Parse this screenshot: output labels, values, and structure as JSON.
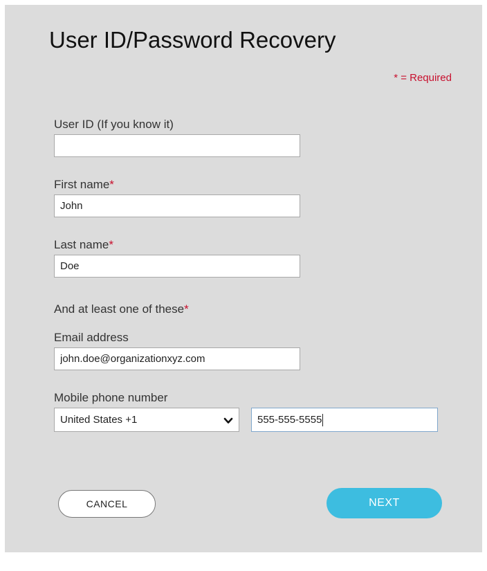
{
  "header": {
    "title": "User ID/Password Recovery",
    "required_note": "* = Required"
  },
  "form": {
    "user_id": {
      "label": "User ID (If you know it)",
      "value": ""
    },
    "first_name": {
      "label": "First name",
      "required_mark": "*",
      "value": "John"
    },
    "last_name": {
      "label": "Last name",
      "required_mark": "*",
      "value": "Doe"
    },
    "at_least_one": {
      "label": "And at least one of these",
      "required_mark": "*"
    },
    "email": {
      "label": "Email address",
      "value": "john.doe@organizationxyz.com"
    },
    "mobile": {
      "label": "Mobile phone number",
      "country_selected": "United States +1",
      "number_value": "555-555-5555"
    }
  },
  "actions": {
    "cancel_label": "CANCEL",
    "next_label": "NEXT"
  },
  "colors": {
    "required_red": "#c8102e",
    "next_button": "#3dbde0",
    "panel_background": "#dcdcdc"
  },
  "icons": {
    "country_dropdown": "chevron-down-icon"
  }
}
